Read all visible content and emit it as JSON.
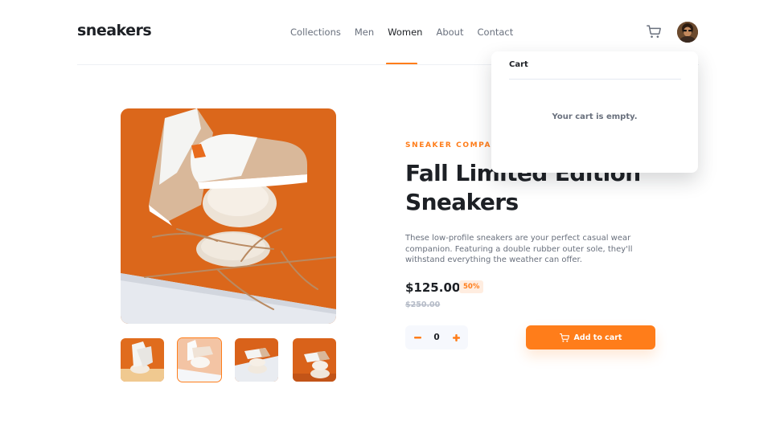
{
  "header": {
    "logo": "sneakers",
    "nav": [
      {
        "label": "Collections"
      },
      {
        "label": "Men"
      },
      {
        "label": "Women",
        "active": true
      },
      {
        "label": "About"
      },
      {
        "label": "Contact"
      }
    ],
    "icons": {
      "cart": "cart-icon",
      "avatar": "avatar"
    }
  },
  "gallery": {
    "thumbnail_count": 4,
    "selected_thumbnail": 2
  },
  "product": {
    "company": "SNEAKER COMPANY",
    "title": "Fall Limited Edition Sneakers",
    "description": "These low-profile sneakers are your perfect casual wear companion. Featuring a double rubber outer sole, they'll withstand everything the weather can offer.",
    "price": "$125.00",
    "discount": "50%",
    "old_price": "$250.00",
    "quantity": "0",
    "add_to_cart_label": "Add to cart"
  },
  "cart": {
    "title": "Cart",
    "empty_message": "Your cart is empty."
  },
  "colors": {
    "accent": "#ff7d1a",
    "accent_light": "#ffede0",
    "text_dark": "#1d2025",
    "text_muted": "#69707d"
  }
}
